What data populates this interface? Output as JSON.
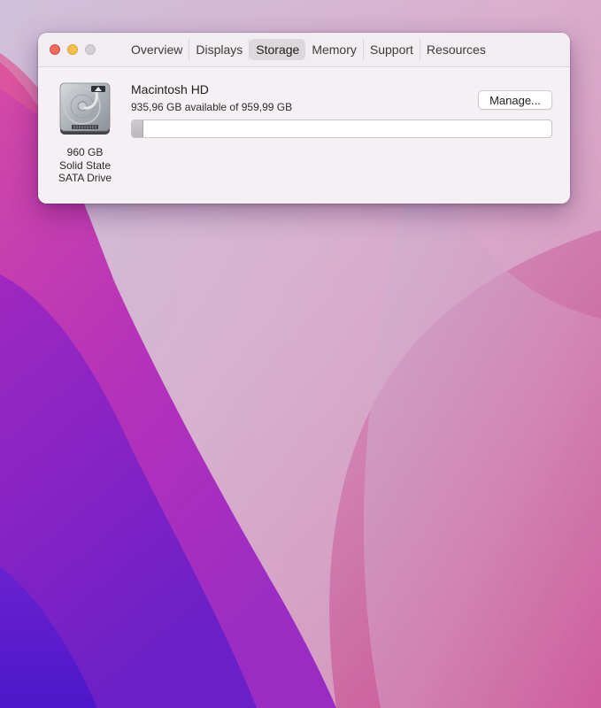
{
  "window": {
    "tabs": [
      {
        "label": "Overview",
        "active": false
      },
      {
        "label": "Displays",
        "active": false
      },
      {
        "label": "Storage",
        "active": true
      },
      {
        "label": "Memory",
        "active": false
      },
      {
        "label": "Support",
        "active": false
      },
      {
        "label": "Resources",
        "active": false
      }
    ]
  },
  "drive": {
    "icon": "hard-drive-icon",
    "capacity": "960 GB",
    "type": "Solid State",
    "interface": "SATA Drive"
  },
  "volume": {
    "name": "Macintosh HD",
    "available_text": "935,96 GB available of 959,99 GB",
    "available_gb": 935.96,
    "total_gb": 959.99,
    "used_fraction": 0.025
  },
  "actions": {
    "manage_label": "Manage..."
  },
  "colors": {
    "close": "#ec6a5e",
    "minimize": "#f4bf4f",
    "zoom": "#d2cfd2"
  }
}
